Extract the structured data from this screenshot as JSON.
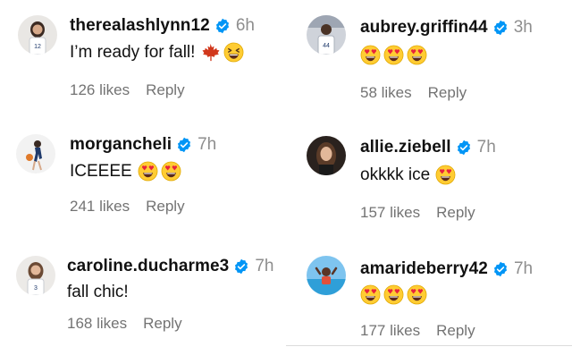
{
  "comments": [
    {
      "username": "therealashlynn12",
      "time": "6h",
      "text": "I’m ready for fall!",
      "emojis": [
        "maple-leaf-icon",
        "grinning-squinting-face-icon"
      ],
      "likes": "126 likes",
      "reply": "Reply"
    },
    {
      "username": "aubrey.griffin44",
      "time": "3h",
      "text": "",
      "emojis": [
        "heart-eyes-icon",
        "heart-eyes-icon",
        "heart-eyes-icon"
      ],
      "likes": "58 likes",
      "reply": "Reply"
    },
    {
      "username": "morgancheli",
      "time": "7h",
      "text": "ICEEEE",
      "emojis": [
        "heart-eyes-icon",
        "heart-eyes-icon"
      ],
      "likes": "241 likes",
      "reply": "Reply"
    },
    {
      "username": "allie.ziebell",
      "time": "7h",
      "text": "okkkk ice",
      "emojis": [
        "heart-eyes-icon"
      ],
      "likes": "157 likes",
      "reply": "Reply"
    },
    {
      "username": "caroline.ducharme3",
      "time": "7h",
      "text": "fall chic!",
      "emojis": [],
      "likes": "168 likes",
      "reply": "Reply"
    },
    {
      "username": "amarideberry42",
      "time": "7h",
      "text": "",
      "emojis": [
        "heart-eyes-icon",
        "heart-eyes-icon",
        "heart-eyes-icon"
      ],
      "likes": "177 likes",
      "reply": "Reply"
    }
  ],
  "colors": {
    "verified": "#0095f6",
    "muted": "#737373",
    "time": "#8e8e8e",
    "text": "#111111"
  }
}
